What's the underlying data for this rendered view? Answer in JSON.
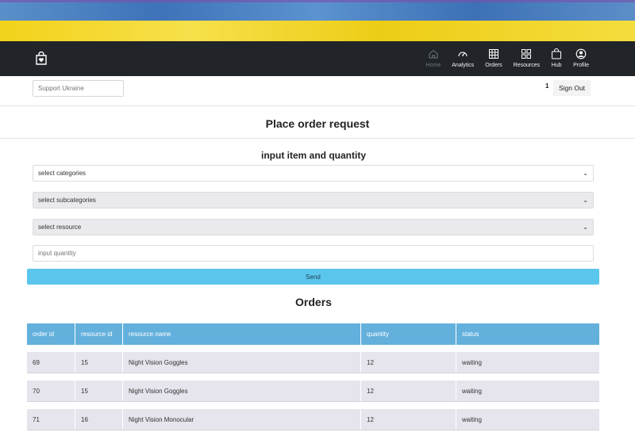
{
  "banner": {
    "colors": {
      "blue": "#4a7fc1",
      "yellow": "#f2d21a"
    }
  },
  "navbar": {
    "brand_icon": "shopping-bag-heart-icon",
    "items": [
      {
        "label": "Home",
        "icon": "home-icon"
      },
      {
        "label": "Analytics",
        "icon": "speedometer-icon"
      },
      {
        "label": "Orders",
        "icon": "table-icon"
      },
      {
        "label": "Resources",
        "icon": "grid-icon"
      },
      {
        "label": "Hub",
        "icon": "bag-icon"
      },
      {
        "label": "Profile",
        "icon": "person-circle-icon"
      }
    ]
  },
  "subheader": {
    "support_placeholder": "Support Ukraine",
    "badge_count": "1",
    "signout_label": "Sign Out"
  },
  "page_title": "Place order request",
  "form": {
    "title": "input item and quantity",
    "category_select": "select categories",
    "subcategory_select": "select subcategories",
    "resource_select": "select resource",
    "quantity_placeholder": "input quantity",
    "send_label": "Send"
  },
  "orders": {
    "title": "Orders",
    "columns": [
      "order id",
      "resource id",
      "resource name",
      "quantity",
      "status"
    ],
    "rows": [
      [
        "69",
        "15",
        "Night Vision Goggles",
        "12",
        "waiting"
      ],
      [
        "70",
        "15",
        "Night Vision Goggles",
        "12",
        "waiting"
      ],
      [
        "71",
        "16",
        "Night Vision Monocular",
        "12",
        "waiting"
      ]
    ]
  }
}
